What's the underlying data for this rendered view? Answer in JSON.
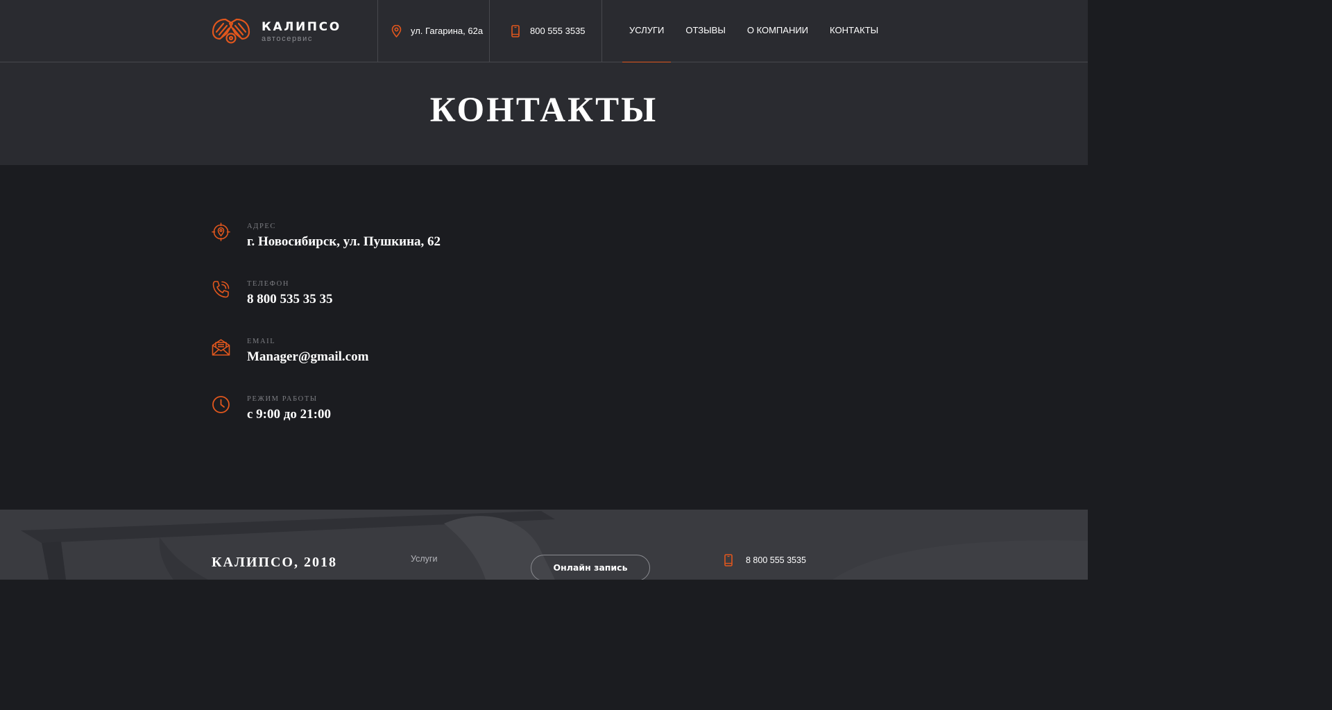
{
  "brand": {
    "name": "КАЛИПСО",
    "tagline": "автосервис",
    "accent_color": "#e2571d"
  },
  "header": {
    "address": {
      "icon": "map-pin-icon",
      "text": "ул. Гагарина, 62а"
    },
    "phone": {
      "icon": "mobile-phone-icon",
      "text": "800 555 3535"
    },
    "nav": [
      {
        "label": "УСЛУГИ",
        "active": true
      },
      {
        "label": "ОТЗЫВЫ",
        "active": false
      },
      {
        "label": "О КОМПАНИИ",
        "active": false
      },
      {
        "label": "КОНТАКТЫ",
        "active": false
      }
    ]
  },
  "page": {
    "title": "КОНТАКТЫ"
  },
  "contacts": [
    {
      "icon": "location-target-icon",
      "label": "АДРЕС",
      "value": "г. Новосибирск, ул. Пушкина, 62"
    },
    {
      "icon": "phone-call-icon",
      "label": "ТЕЛЕФОН",
      "value": "8 800 535 35 35"
    },
    {
      "icon": "envelope-icon",
      "label": "EMAIL",
      "value": "Manager@gmail.com"
    },
    {
      "icon": "clock-icon",
      "label": "РЕЖИМ РАБОТЫ",
      "value": "с 9:00 до 21:00"
    }
  ],
  "footer": {
    "brand": "КАЛИПСО, 2018",
    "link": "Услуги",
    "button": "Онлайн запись",
    "phone": {
      "icon": "mobile-phone-icon",
      "text": "8 800 555 3535"
    }
  }
}
